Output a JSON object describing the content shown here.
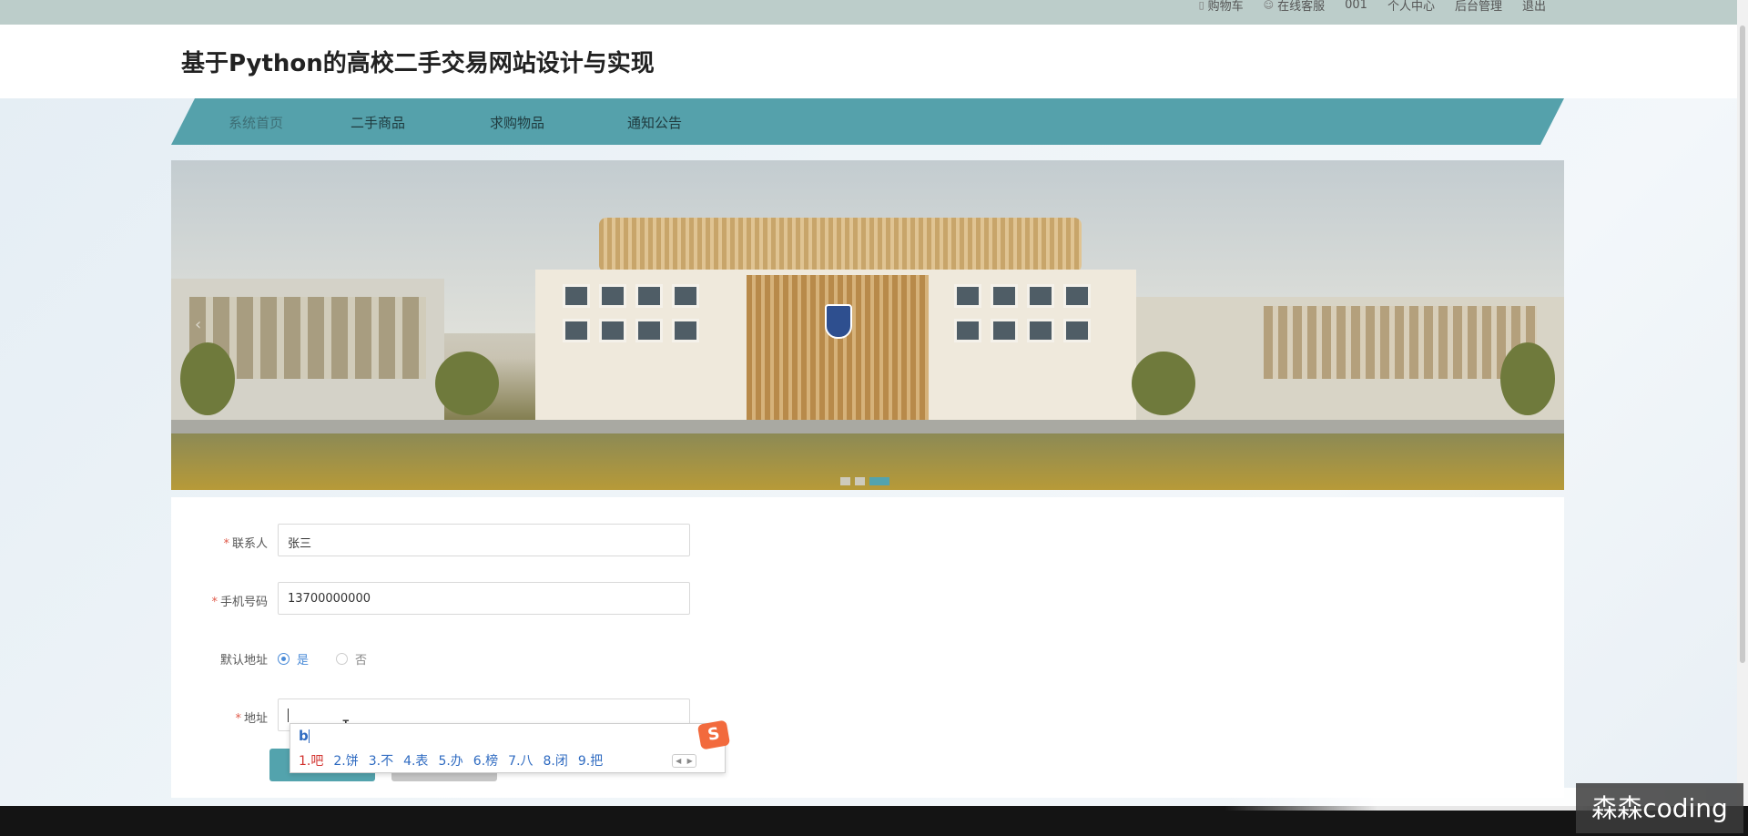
{
  "topbar": {
    "links": [
      {
        "icon": "cart-icon",
        "label": "购物车"
      },
      {
        "icon": "user-service-icon",
        "label": "在线客服"
      },
      {
        "icon": "",
        "label": "001"
      },
      {
        "icon": "",
        "label": "个人中心"
      },
      {
        "icon": "",
        "label": "后台管理"
      },
      {
        "icon": "",
        "label": "退出"
      }
    ]
  },
  "header": {
    "title": "基于Python的高校二手交易网站设计与实现"
  },
  "nav": {
    "items": [
      {
        "label": "系统首页"
      },
      {
        "label": "二手商品"
      },
      {
        "label": "求购物品"
      },
      {
        "label": "通知公告"
      }
    ]
  },
  "banner": {
    "slide_count": 3,
    "active_slide": 3
  },
  "form": {
    "contact": {
      "label": "联系人",
      "value": "张三",
      "required": true
    },
    "phone": {
      "label": "手机号码",
      "value": "13700000000",
      "required": true
    },
    "default_address": {
      "label": "默认地址",
      "options": [
        "是",
        "否"
      ],
      "selected": "是"
    },
    "address": {
      "label": "地址",
      "value": "",
      "required": true
    }
  },
  "ime": {
    "composition": "b",
    "candidates": [
      "1.吧",
      "2.饼",
      "3.不",
      "4.表",
      "5.办",
      "6.榜",
      "7.八",
      "8.闭",
      "9.把"
    ],
    "logo": "S"
  },
  "watermark": "森森coding",
  "colors": {
    "accent": "#53a3ad",
    "topbar": "#bccdca",
    "required": "#e05a4a",
    "radio": "#4a8bd8"
  }
}
